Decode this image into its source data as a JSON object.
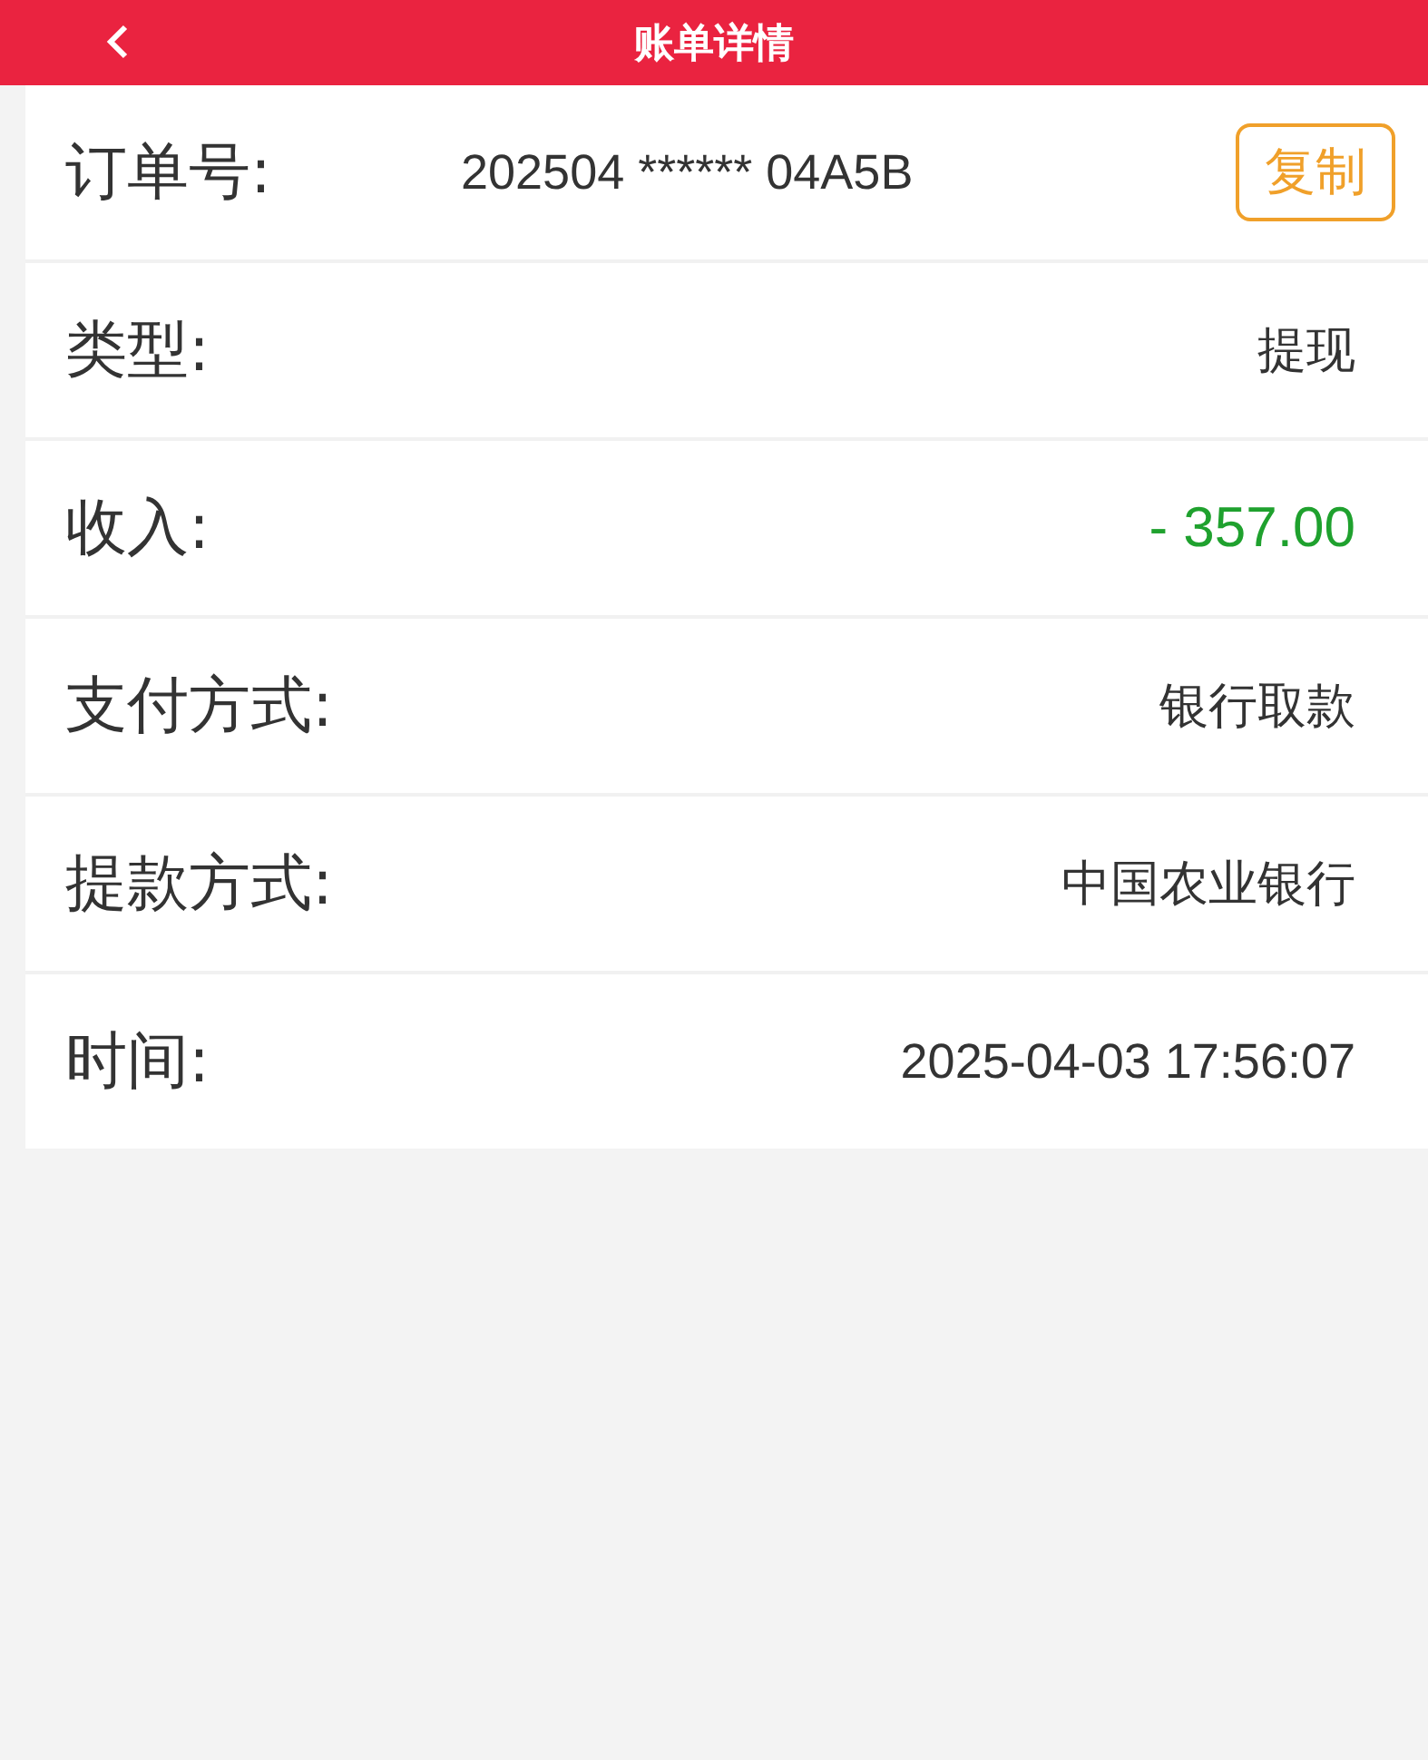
{
  "header": {
    "title": "账单详情"
  },
  "rows": [
    {
      "label": "订单号:",
      "value": "202504 ****** 04A5B",
      "kind": "order",
      "button": "复制"
    },
    {
      "label": "类型:",
      "value": "提现",
      "kind": "plain"
    },
    {
      "label": "收入:",
      "value": "- 357.00",
      "kind": "amount"
    },
    {
      "label": "支付方式:",
      "value": "银行取款",
      "kind": "plain"
    },
    {
      "label": "提款方式:",
      "value": "中国农业银行",
      "kind": "plain"
    },
    {
      "label": "时间:",
      "value": "2025-04-03 17:56:07",
      "kind": "plain"
    }
  ]
}
